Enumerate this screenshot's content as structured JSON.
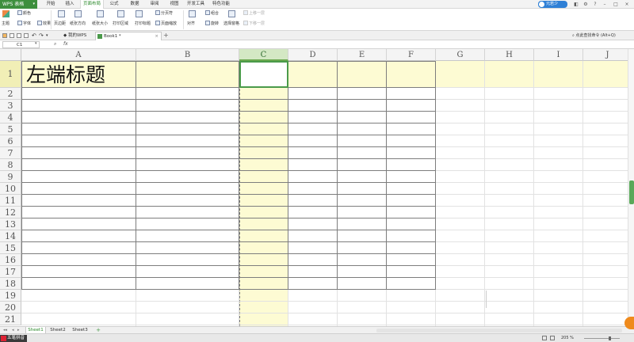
{
  "app": {
    "name": "WPS 表格"
  },
  "menu": {
    "items": [
      {
        "label": "开始"
      },
      {
        "label": "插入"
      },
      {
        "label": "页面布局",
        "active": true
      },
      {
        "label": "公式"
      },
      {
        "label": "数据"
      },
      {
        "label": "审阅"
      },
      {
        "label": "视图"
      },
      {
        "label": "开发工具"
      },
      {
        "label": "特色功能"
      }
    ]
  },
  "user": {
    "name": "元若少"
  },
  "ribbon": {
    "theme": "主题",
    "colors": "颜色",
    "font": "字体",
    "effects": "效果",
    "page_margin": "页边距",
    "orientation": "纸张方向",
    "paper_size": "纸张大小",
    "print_area": "打印区域",
    "page_break": "分页符",
    "print_titles": "打印标题",
    "print_zoom": "页面缩放",
    "align": "对齐",
    "rotate": "旋转",
    "combine": "组合",
    "select_pane": "选择窗格",
    "bring_forward": "上移一层",
    "send_backward": "下移一层"
  },
  "tabs": {
    "my_wps": "我的WPS",
    "book": "Book1 *"
  },
  "help": {
    "text": "点此查找命令 (Alt+Q)"
  },
  "formula_bar": {
    "cell_ref": "C1",
    "fx": "fx",
    "value": ""
  },
  "grid": {
    "columns": [
      "A",
      "B",
      "C",
      "D",
      "E",
      "F",
      "G",
      "H",
      "I",
      "J"
    ],
    "selected_column": "C",
    "rows": [
      "1",
      "2",
      "3",
      "4",
      "5",
      "6",
      "7",
      "8",
      "9",
      "10",
      "11",
      "12",
      "13",
      "14",
      "15",
      "16",
      "17",
      "18",
      "19",
      "20",
      "21"
    ],
    "cells": {
      "A1": "左端标题"
    },
    "active_cell": "C1"
  },
  "sheets": [
    "Sheet1",
    "Sheet2",
    "Sheet3"
  ],
  "active_sheet": "Sheet1",
  "status": {
    "ime": "五笔拼音",
    "zoom": "205 %"
  },
  "colors": {
    "accent": "#3d8f3d",
    "highlight": "#fdfbd3",
    "selection": "#4a9a4a"
  }
}
